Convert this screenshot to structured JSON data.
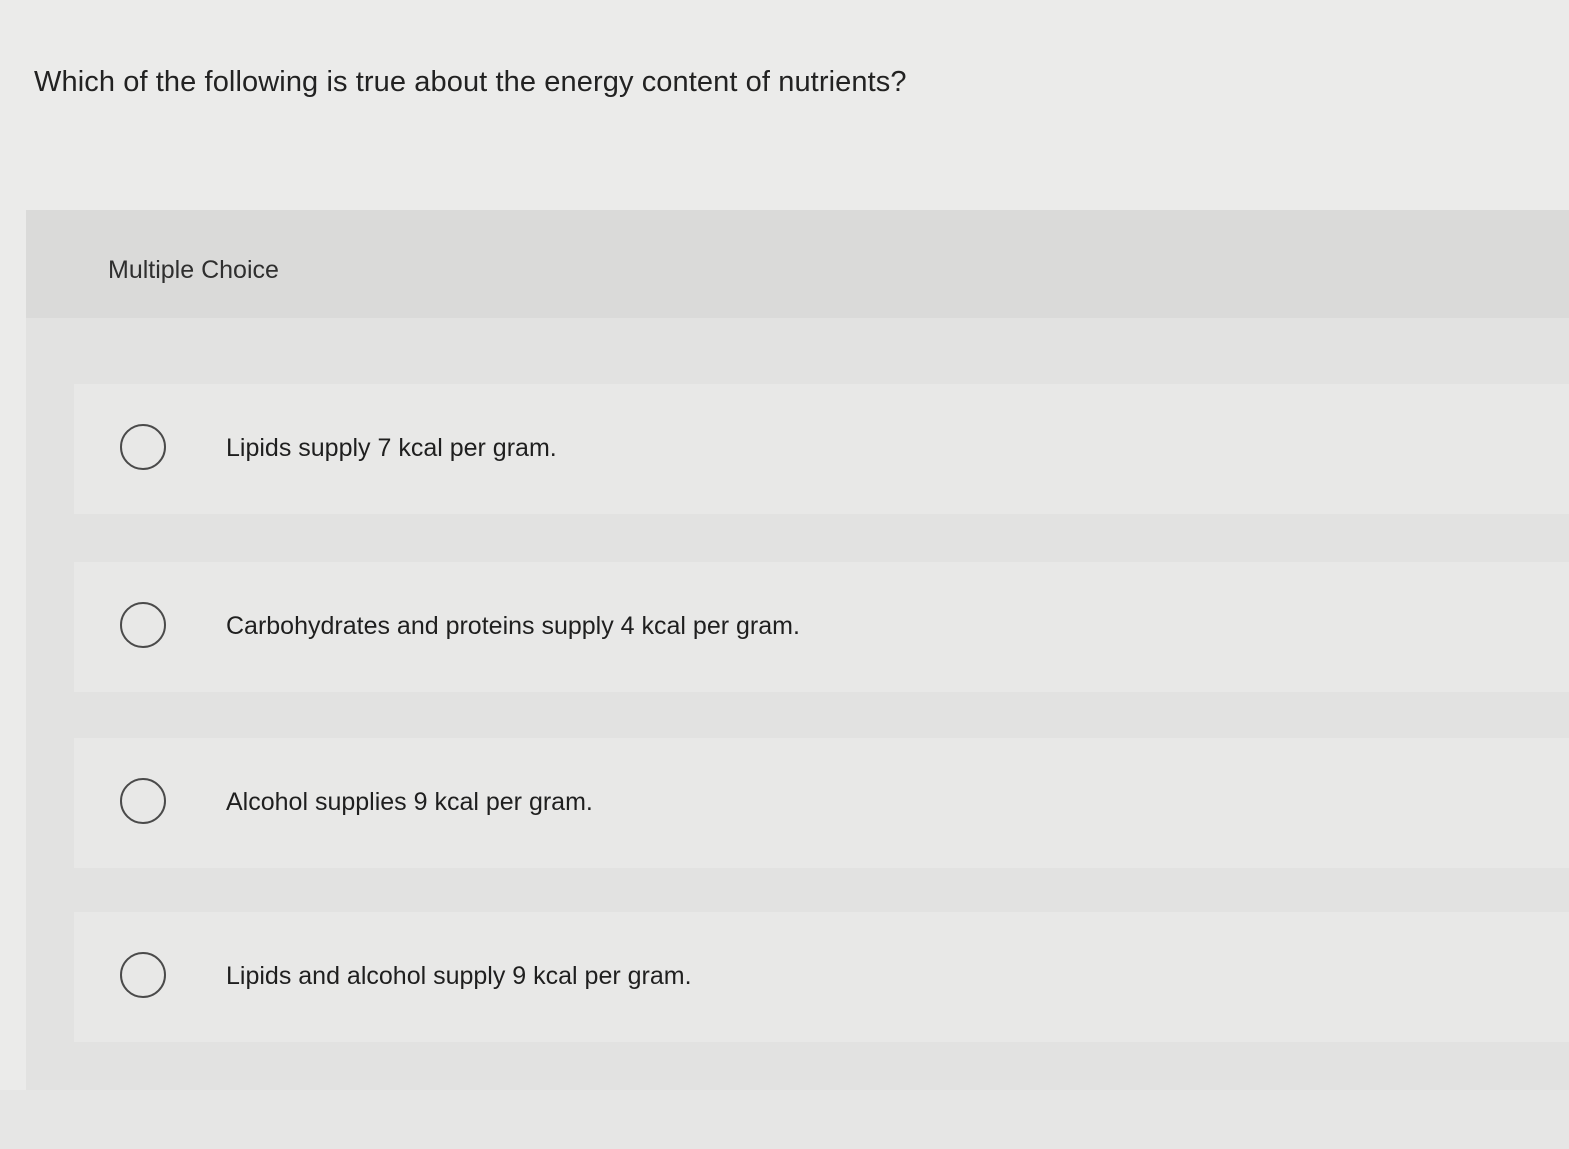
{
  "question": {
    "text": "Which of the following is true about the energy content of nutrients?"
  },
  "panel": {
    "label": "Multiple Choice"
  },
  "options": [
    {
      "label": "Lipids supply 7 kcal per gram."
    },
    {
      "label": "Carbohydrates and proteins supply 4 kcal per gram."
    },
    {
      "label": "Alcohol supplies 9 kcal per gram."
    },
    {
      "label": "Lipids and alcohol supply 9 kcal per gram."
    }
  ]
}
